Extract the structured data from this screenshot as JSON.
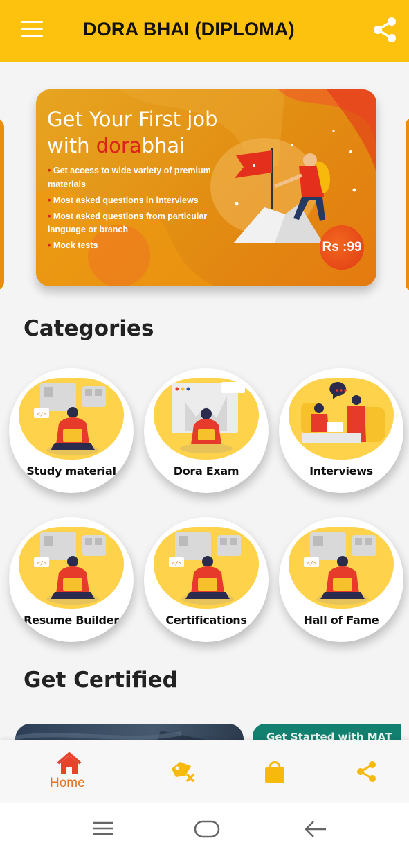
{
  "header": {
    "title": "DORA BHAI (DIPLOMA)",
    "menu_icon": "hamburger-menu-icon",
    "share_icon": "share-icon",
    "background": "#fdc20d"
  },
  "banner": {
    "headline_line1": "Get Your First job",
    "headline_with": "with ",
    "brand_dora": "dora",
    "brand_bhai": "bhai",
    "bullets": [
      "Get access to wide variety of premium materials",
      "Most asked questions in interviews",
      "Most asked questions from particular language or branch",
      "Mock tests"
    ],
    "price": "Rs :99"
  },
  "categories": {
    "title": "Categories",
    "items": [
      {
        "label": "Study material"
      },
      {
        "label": "Dora Exam"
      },
      {
        "label": "Interviews"
      },
      {
        "label": "Resume Builder"
      },
      {
        "label": "Certifications"
      },
      {
        "label": "Hall of Fame"
      }
    ]
  },
  "certified": {
    "title": "Get Certified",
    "card2_text": "Get Started with MAT"
  },
  "bottom_nav": {
    "home_label": "Home",
    "items": [
      "home-icon",
      "badge-x-icon",
      "shopping-bag-icon",
      "share-icon"
    ],
    "active_color": "#e8711f",
    "icon_color": "#f6b90c"
  },
  "system_nav": [
    "recent-apps-icon",
    "home-pill-icon",
    "back-arrow-icon"
  ]
}
